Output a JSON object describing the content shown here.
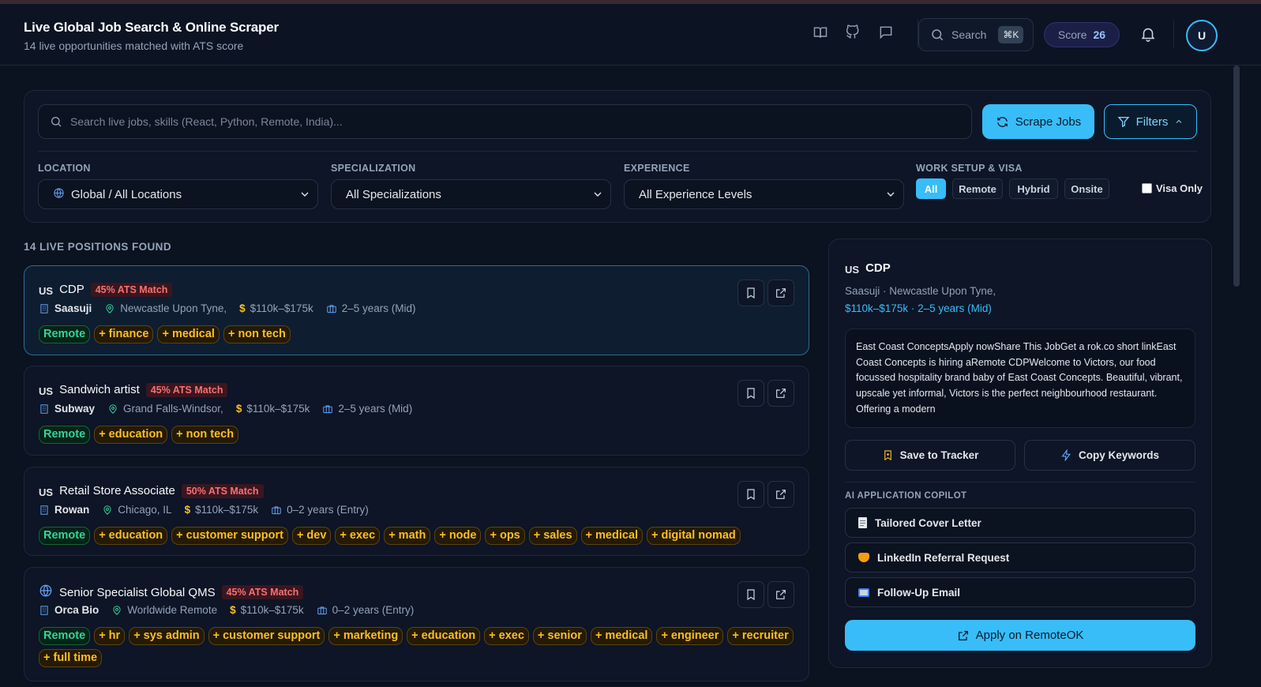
{
  "header": {
    "title": "Live Global Job Search & Online Scraper",
    "subtitle": "14 live opportunities matched with ATS score",
    "search_label": "Search",
    "search_kbd": "⌘K",
    "score_label": "Score",
    "score_value": "26",
    "avatar_initial": "U"
  },
  "search": {
    "placeholder": "Search live jobs, skills (React, Python, Remote, India)...",
    "scrape_label": "Scrape Jobs",
    "filters_label": "Filters"
  },
  "filters": {
    "location_label": "LOCATION",
    "location_value": "Global / All Locations",
    "specialization_label": "SPECIALIZATION",
    "specialization_value": "All Specializations",
    "experience_label": "EXPERIENCE",
    "experience_value": "All Experience Levels",
    "worksetup_label": "WORK SETUP & VISA",
    "setup_options": [
      "All",
      "Remote",
      "Hybrid",
      "Onsite"
    ],
    "setup_selected": "All",
    "visa_label": "Visa Only",
    "visa_checked": false
  },
  "results": {
    "count_label": "14 LIVE POSITIONS FOUND",
    "jobs": [
      {
        "flag": "US",
        "title": "CDP",
        "ats": "45% ATS Match",
        "company": "Saasuji",
        "location": "Newcastle Upon Tyne,",
        "salary": "$110k–$175k",
        "experience": "2–5 years (Mid)",
        "tags": [
          "Remote",
          "+ finance",
          "+ medical",
          "+ non tech"
        ]
      },
      {
        "flag": "US",
        "title": "Sandwich artist",
        "ats": "45% ATS Match",
        "company": "Subway",
        "location": "Grand Falls-Windsor,",
        "salary": "$110k–$175k",
        "experience": "2–5 years (Mid)",
        "tags": [
          "Remote",
          "+ education",
          "+ non tech"
        ]
      },
      {
        "flag": "US",
        "title": "Retail Store Associate",
        "ats": "50% ATS Match",
        "company": "Rowan",
        "location": "Chicago, IL",
        "salary": "$110k–$175k",
        "experience": "0–2 years (Entry)",
        "tags": [
          "Remote",
          "+ education",
          "+ customer support",
          "+ dev",
          "+ exec",
          "+ math",
          "+ node",
          "+ ops",
          "+ sales",
          "+ medical",
          "+ digital nomad"
        ]
      },
      {
        "flag": "globe",
        "title": "Senior Specialist Global QMS",
        "ats": "45% ATS Match",
        "company": "Orca Bio",
        "location": "Worldwide Remote",
        "salary": "$110k–$175k",
        "experience": "0–2 years (Entry)",
        "tags": [
          "Remote",
          "+ hr",
          "+ sys admin",
          "+ customer support",
          "+ marketing",
          "+ education",
          "+ exec",
          "+ senior",
          "+ medical",
          "+ engineer",
          "+ recruiter",
          "+ full time"
        ]
      }
    ]
  },
  "detail": {
    "flag": "US",
    "title": "CDP",
    "company_line": "Saasuji · Newcastle Upon Tyne,",
    "salary_line": "$110k–$175k · 2–5 years (Mid)",
    "description": "East Coast ConceptsApply nowShare This JobGet a rok.co short linkEast Coast Concepts is hiring aRemote CDPWelcome to Victors, our food focussed hospitality brand baby of East Coast Concepts. Beautiful, vibrant, upscale yet informal, Victors is the perfect neighbourhood restaurant. Offering a modern",
    "save_label": "Save to Tracker",
    "copy_label": "Copy Keywords",
    "copilot_label": "AI APPLICATION COPILOT",
    "copilot_items": [
      "Tailored Cover Letter",
      "LinkedIn Referral Request",
      "Follow-Up Email"
    ],
    "apply_label": "Apply on RemoteOK"
  },
  "colors": {
    "accent": "#38bdf8",
    "ats": "#f87171",
    "tag": "#fbbf24",
    "remote": "#34d399"
  }
}
